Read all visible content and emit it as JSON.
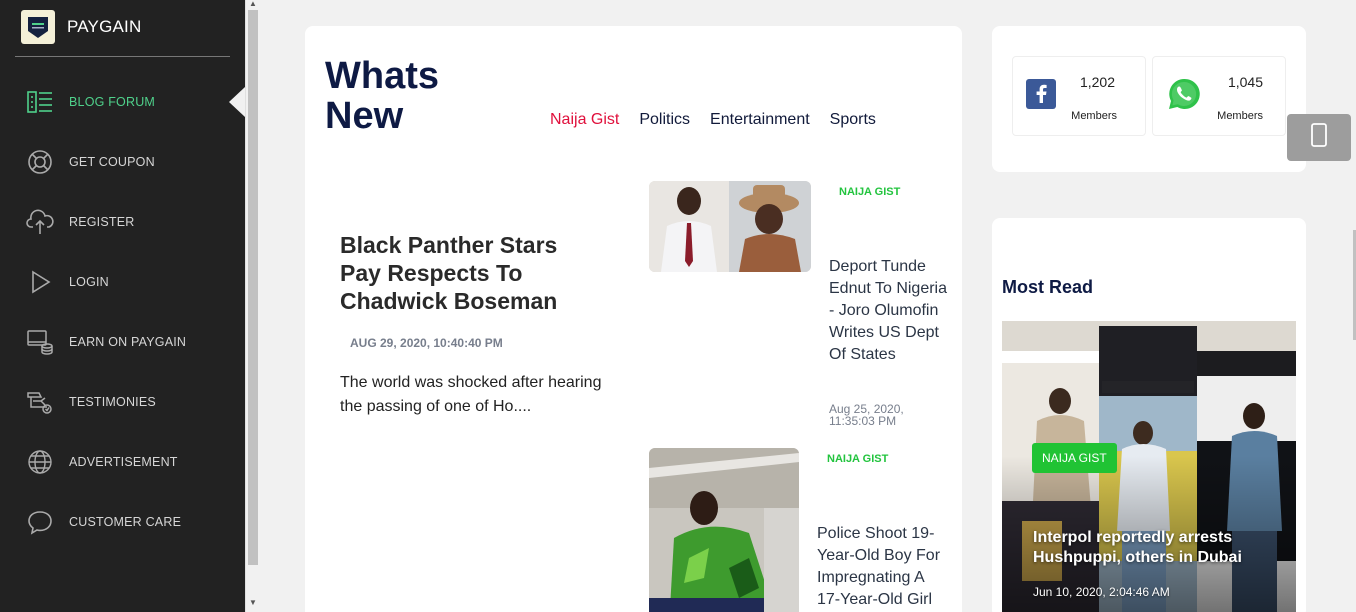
{
  "brand": {
    "name": "PAYGAIN"
  },
  "sidebar": {
    "items": [
      {
        "label": "BLOG FORUM",
        "icon": "blog-icon",
        "active": true
      },
      {
        "label": "GET COUPON",
        "icon": "lifebuoy-icon"
      },
      {
        "label": "REGISTER",
        "icon": "cloud-upload-icon"
      },
      {
        "label": "LOGIN",
        "icon": "play-icon"
      },
      {
        "label": "EARN ON PAYGAIN",
        "icon": "earn-icon"
      },
      {
        "label": "TESTIMONIES",
        "icon": "testimony-icon"
      },
      {
        "label": "ADVERTISEMENT",
        "icon": "globe-icon"
      },
      {
        "label": "CUSTOMER CARE",
        "icon": "chat-icon"
      }
    ]
  },
  "main": {
    "title_line1": "Whats",
    "title_line2": "New",
    "tabs": [
      {
        "label": "Naija Gist",
        "active": true
      },
      {
        "label": "Politics"
      },
      {
        "label": "Entertainment"
      },
      {
        "label": "Sports"
      }
    ],
    "featured": {
      "title": "Black Panther Stars Pay Respects To Chadwick Boseman",
      "date": "AUG 29, 2020, 10:40:40 PM",
      "excerpt": "The world was shocked after hearing the passing of one of Ho...."
    },
    "articles": [
      {
        "category": "NAIJA GIST",
        "title": "Deport Tunde Ednut To Nigeria - Joro Olumofin Writes US Dept Of States",
        "date": "Aug 25, 2020, 11:35:03 PM"
      },
      {
        "category": "NAIJA GIST",
        "title": "Police Shoot 19-Year-Old Boy For Impregnating A 17-Year-Old Girl"
      }
    ]
  },
  "social": {
    "facebook": {
      "count": "1,202",
      "label": "Members",
      "icon": "facebook-icon",
      "color": "#3b5998"
    },
    "whatsapp": {
      "count": "1,045",
      "label": "Members",
      "icon": "whatsapp-icon",
      "color": "#25d366"
    }
  },
  "most_read": {
    "title": "Most Read",
    "badge": "NAIJA GIST",
    "headline": "Interpol reportedly arrests Hushpuppi, others in Dubai",
    "date": "Jun 10, 2020, 2:04:46 AM"
  },
  "colors": {
    "accent_green": "#4fd18b",
    "tab_active": "#e0103c",
    "category_green": "#22c43e",
    "title_navy": "#0e1a44"
  }
}
